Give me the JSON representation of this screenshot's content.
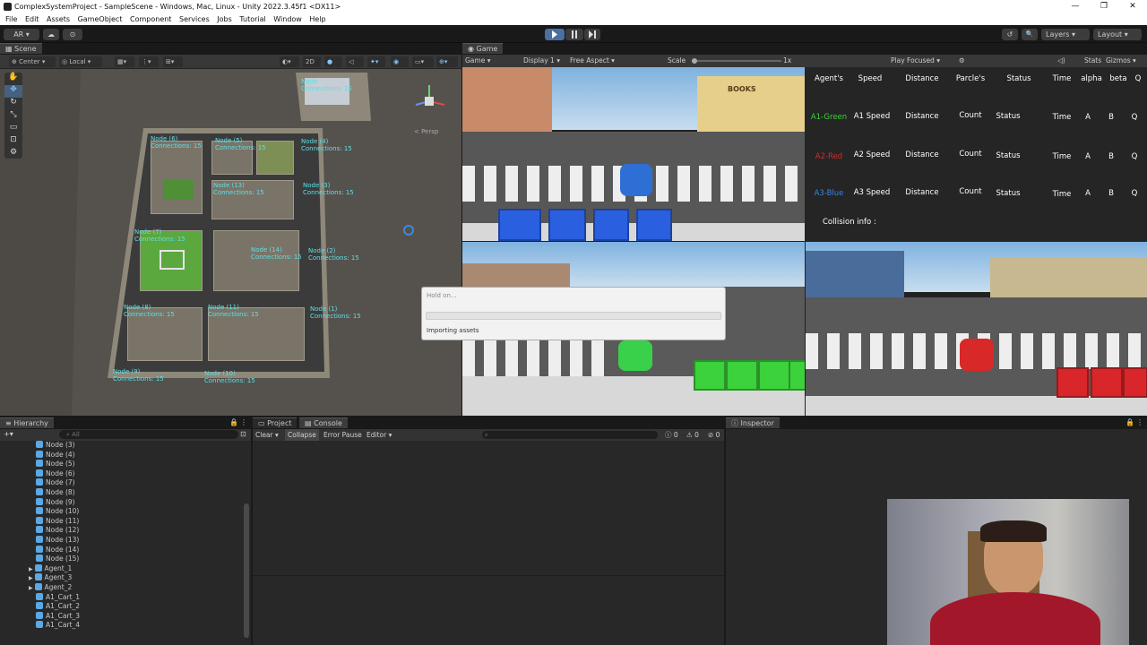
{
  "window": {
    "title": "ComplexSystemProject - SampleScene - Windows, Mac, Linux - Unity 2022.3.45f1 <DX11>",
    "min": "—",
    "max": "❐",
    "close": "✕"
  },
  "menu": [
    "File",
    "Edit",
    "Assets",
    "GameObject",
    "Component",
    "Services",
    "Jobs",
    "Tutorial",
    "Window",
    "Help"
  ],
  "toolbar": {
    "account": "AR ▾",
    "cloud": "☁",
    "collab": "⊙",
    "layers": "Layers",
    "layout": "Layout",
    "history_icon": "↺",
    "search_icon": "🔍"
  },
  "scene": {
    "tab": "Scene",
    "pivot": "Center",
    "space": "Local",
    "mode_2d": "2D",
    "persp": "< Persp",
    "nodes": [
      {
        "label": "Node (4)",
        "conn": "Connections: 15"
      },
      {
        "label": "Node (5)",
        "conn": "Connections: 15"
      },
      {
        "label": "Node (6)",
        "conn": "Connections: 15"
      },
      {
        "label": "Node (3)",
        "conn": "Connections: 15"
      },
      {
        "label": "Node (13)",
        "conn": "Connections: 15"
      },
      {
        "label": "Node (7)",
        "conn": "Connections: 15"
      },
      {
        "label": "Node (2)",
        "conn": "Connections: 15"
      },
      {
        "label": "Node (14)",
        "conn": "Connections: 15"
      },
      {
        "label": "Node (8)",
        "conn": "Connections: 15"
      },
      {
        "label": "Node (11)",
        "conn": "Connections: 15"
      },
      {
        "label": "Node (1)",
        "conn": "Connections: 15"
      },
      {
        "label": "Node (9)",
        "conn": "Connections: 15"
      },
      {
        "label": "Node (10)",
        "conn": "Connections: 15"
      },
      {
        "label": "Node",
        "conn": "Connections: 15"
      }
    ]
  },
  "game": {
    "tab": "Game",
    "view": "Game",
    "display": "Display 1",
    "aspect": "Free Aspect",
    "scale_label": "Scale",
    "scale_value": "1x",
    "play_focused": "Play Focused",
    "stats": "Stats",
    "gizmos": "Gizmos",
    "shop_sign": "BOOKS"
  },
  "table": {
    "headers": [
      "Agent's",
      "Speed",
      "Distance",
      "Parcle's",
      "Status",
      "Time",
      "alpha",
      "beta",
      "Q"
    ],
    "rows": [
      {
        "agent": "A1-Green",
        "color": "#3bd23b",
        "speed": "A1 Speed",
        "dist": "Distance",
        "count": "Count",
        "status": "Status",
        "time": "Time",
        "a": "A",
        "b": "B",
        "q": "Q"
      },
      {
        "agent": "A2-Red",
        "color": "#d22b2b",
        "speed": "A2 Speed",
        "dist": "Distance",
        "count": "Count",
        "status": "Status",
        "time": "Time",
        "a": "A",
        "b": "B",
        "q": "Q"
      },
      {
        "agent": "A3-Blue",
        "color": "#3a82e6",
        "speed": "A3 Speed",
        "dist": "Distance",
        "count": "Count",
        "status": "Status",
        "time": "Time",
        "a": "A",
        "b": "B",
        "q": "Q"
      }
    ],
    "collision": "Collision info :"
  },
  "progress": {
    "title": "Hold on...",
    "status": "Importing assets",
    "fraction": 0.0
  },
  "hierarchy": {
    "tab": "Hierarchy",
    "search_placeholder": "All",
    "items": [
      "Node (3)",
      "Node (4)",
      "Node (5)",
      "Node (6)",
      "Node (7)",
      "Node (8)",
      "Node (9)",
      "Node (10)",
      "Node (11)",
      "Node (12)",
      "Node (13)",
      "Node (14)",
      "Node (15)",
      "Agent_1",
      "Agent_3",
      "Agent_2",
      "A1_Cart_1",
      "A1_Cart_2",
      "A1_Cart_3",
      "A1_Cart_4"
    ]
  },
  "console": {
    "tab_project": "Project",
    "tab_console": "Console",
    "clear": "Clear",
    "collapse": "Collapse",
    "error_pause": "Error Pause",
    "editor": "Editor",
    "count_info": "0",
    "count_warn": "0",
    "count_err": "0"
  },
  "inspector": {
    "tab": "Inspector"
  }
}
